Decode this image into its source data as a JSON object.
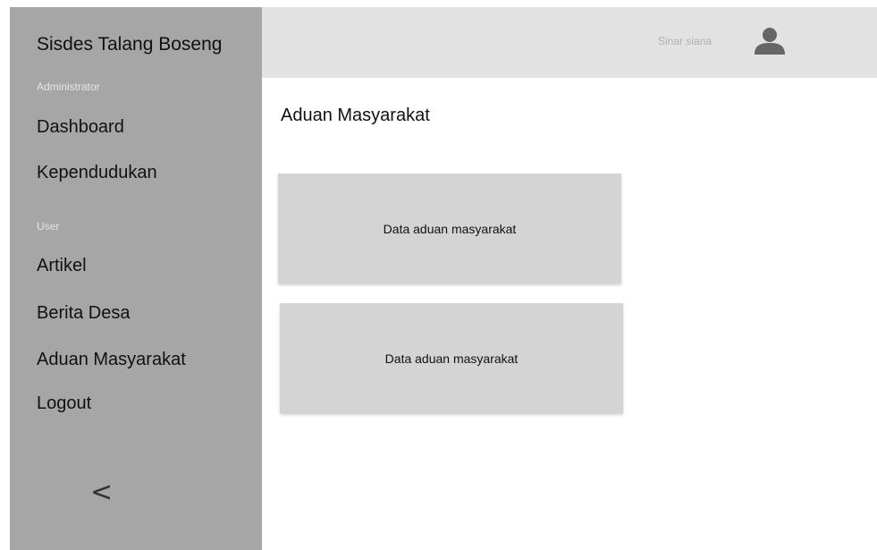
{
  "sidebar": {
    "brand": "Sisdes Talang Boseng",
    "sections": [
      {
        "label": "Administrator",
        "items": [
          {
            "label": "Dashboard"
          },
          {
            "label": "Kependudukan"
          }
        ]
      },
      {
        "label": "User",
        "items": [
          {
            "label": "Artikel"
          },
          {
            "label": "Berita Desa"
          },
          {
            "label": "Aduan Masyarakat"
          },
          {
            "label": "Logout"
          }
        ]
      }
    ],
    "collapse_glyph": "<"
  },
  "header": {
    "user_name": "Sinar siana",
    "avatar_icon": "user-icon"
  },
  "main": {
    "title": "Aduan Masyarakat",
    "cards": [
      {
        "label": "Data aduan masyarakat"
      },
      {
        "label": "Data aduan masyarakat"
      }
    ]
  },
  "colors": {
    "sidebar_bg": "#a6a6a6",
    "header_bg": "#e2e2e2",
    "card_bg": "#d4d4d4"
  }
}
